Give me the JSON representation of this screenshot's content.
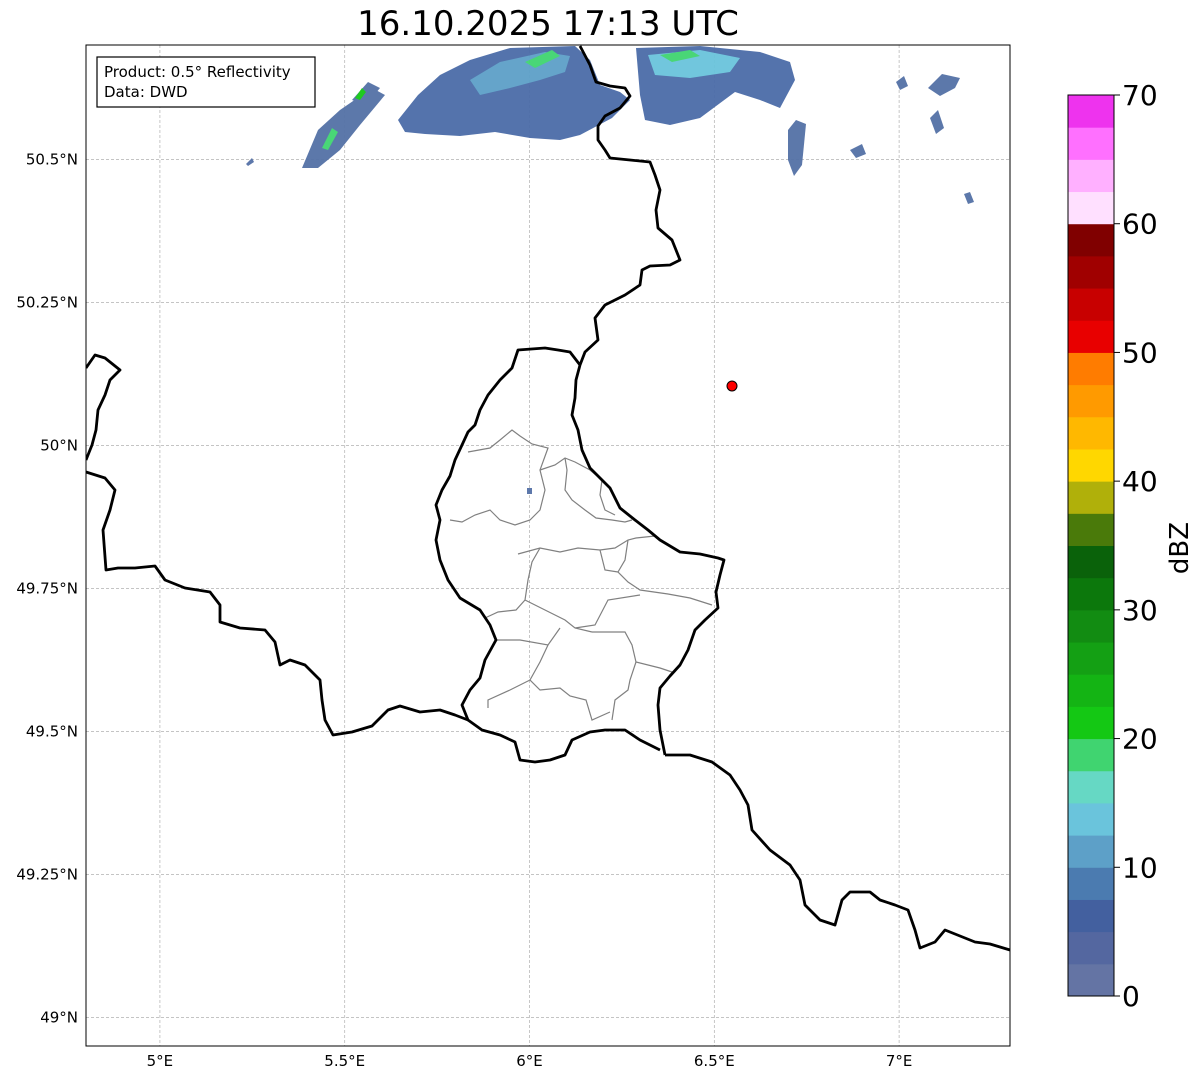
{
  "title": "16.10.2025 17:13 UTC",
  "info_box": {
    "line1": "Product: 0.5° Reflectivity",
    "line2": "Data: DWD"
  },
  "map": {
    "lon_range": [
      4.8,
      7.3
    ],
    "lat_range": [
      48.95,
      50.7
    ],
    "x_ticks": [
      {
        "value": 5.0,
        "label": "5°E"
      },
      {
        "value": 5.5,
        "label": "5.5°E"
      },
      {
        "value": 6.0,
        "label": "6°E"
      },
      {
        "value": 6.5,
        "label": "6.5°E"
      },
      {
        "value": 7.0,
        "label": "7°E"
      }
    ],
    "y_ticks": [
      {
        "value": 50.5,
        "label": "50.5°N"
      },
      {
        "value": 50.25,
        "label": "50.25°N"
      },
      {
        "value": 50.0,
        "label": "50°N"
      },
      {
        "value": 49.75,
        "label": "49.75°N"
      },
      {
        "value": 49.5,
        "label": "49.5°N"
      },
      {
        "value": 49.25,
        "label": "49.25°N"
      },
      {
        "value": 49.0,
        "label": "49°N"
      }
    ],
    "grid": true,
    "marker": {
      "lon": 6.55,
      "lat": 50.11,
      "color": "#ff0000"
    }
  },
  "colorbar": {
    "label": "dBZ",
    "min": 0,
    "max": 70,
    "step": 2.5,
    "tick_values": [
      0,
      10,
      20,
      30,
      40,
      50,
      60,
      70
    ],
    "colors": [
      "#6474a4",
      "#5467a0",
      "#43609f",
      "#4b7bb0",
      "#5da0c8",
      "#6ac4dc",
      "#66d8c4",
      "#40d470",
      "#14c814",
      "#14b414",
      "#14a014",
      "#128c12",
      "#0c780c",
      "#0a620a",
      "#4a7a0a",
      "#b0b00a",
      "#ffd700",
      "#ffb800",
      "#ff9a00",
      "#ff7c00",
      "#e80000",
      "#c80000",
      "#a00000",
      "#800000",
      "#ffe0ff",
      "#ffb0ff",
      "#ff70ff",
      "#ee33ee"
    ]
  }
}
